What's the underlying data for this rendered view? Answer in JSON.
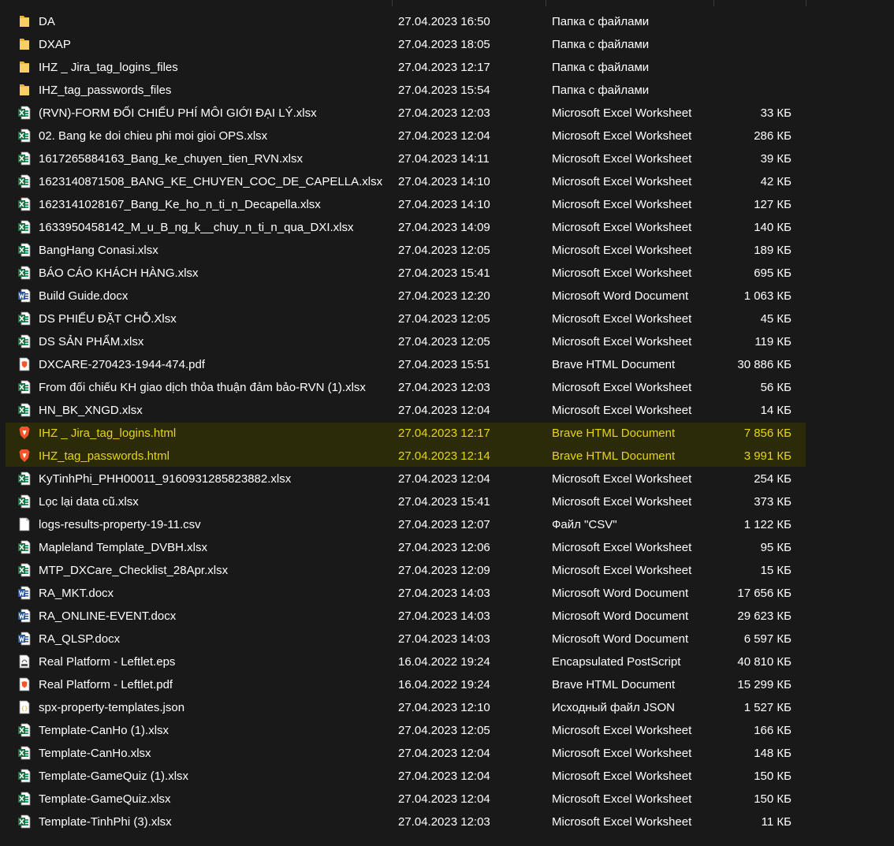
{
  "files": [
    {
      "name": "DA",
      "date": "27.04.2023 16:50",
      "type": "Папка с файлами",
      "size": "",
      "icon": "folder-icon"
    },
    {
      "name": "DXAP",
      "date": "27.04.2023 18:05",
      "type": "Папка с файлами",
      "size": "",
      "icon": "folder-icon"
    },
    {
      "name": "IHZ _ Jira_tag_logins_files",
      "date": "27.04.2023 12:17",
      "type": "Папка с файлами",
      "size": "",
      "icon": "folder-icon"
    },
    {
      "name": "IHZ_tag_passwords_files",
      "date": "27.04.2023 15:54",
      "type": "Папка с файлами",
      "size": "",
      "icon": "folder-icon"
    },
    {
      "name": "(RVN)-FORM ĐỐI CHIẾU PHÍ MÔI GIỚI ĐẠI LÝ.xlsx",
      "date": "27.04.2023 12:03",
      "type": "Microsoft Excel Worksheet",
      "size": "33 КБ",
      "icon": "excel-icon"
    },
    {
      "name": "02. Bang ke doi chieu phi moi gioi OPS.xlsx",
      "date": "27.04.2023 12:04",
      "type": "Microsoft Excel Worksheet",
      "size": "286 КБ",
      "icon": "excel-icon"
    },
    {
      "name": "1617265884163_Bang_ke_chuyen_tien_RVN.xlsx",
      "date": "27.04.2023 14:11",
      "type": "Microsoft Excel Worksheet",
      "size": "39 КБ",
      "icon": "excel-icon"
    },
    {
      "name": "1623140871508_BANG_KE_CHUYEN_COC_DE_CAPELLA.xlsx",
      "date": "27.04.2023 14:10",
      "type": "Microsoft Excel Worksheet",
      "size": "42 КБ",
      "icon": "excel-icon"
    },
    {
      "name": "1623141028167_Bang_Ke_ho_n_ti_n_Decapella.xlsx",
      "date": "27.04.2023 14:10",
      "type": "Microsoft Excel Worksheet",
      "size": "127 КБ",
      "icon": "excel-icon"
    },
    {
      "name": "1633950458142_M_u_B_ng_k__chuy_n_ti_n_qua_DXI.xlsx",
      "date": "27.04.2023 14:09",
      "type": "Microsoft Excel Worksheet",
      "size": "140 КБ",
      "icon": "excel-icon"
    },
    {
      "name": "BangHang Conasi.xlsx",
      "date": "27.04.2023 12:05",
      "type": "Microsoft Excel Worksheet",
      "size": "189 КБ",
      "icon": "excel-icon"
    },
    {
      "name": "BÁO CÁO KHÁCH HÀNG.xlsx",
      "date": "27.04.2023 15:41",
      "type": "Microsoft Excel Worksheet",
      "size": "695 КБ",
      "icon": "excel-icon"
    },
    {
      "name": "Build Guide.docx",
      "date": "27.04.2023 12:20",
      "type": "Microsoft Word Document",
      "size": "1 063 КБ",
      "icon": "word-icon"
    },
    {
      "name": "DS PHIẾU ĐẶT CHỖ.Xlsx",
      "date": "27.04.2023 12:05",
      "type": "Microsoft Excel Worksheet",
      "size": "45 КБ",
      "icon": "excel-icon"
    },
    {
      "name": "DS SẢN PHẨM.xlsx",
      "date": "27.04.2023 12:05",
      "type": "Microsoft Excel Worksheet",
      "size": "119 КБ",
      "icon": "excel-icon"
    },
    {
      "name": "DXCARE-270423-1944-474.pdf",
      "date": "27.04.2023 15:51",
      "type": "Brave HTML Document",
      "size": "30 886 КБ",
      "icon": "pdf-icon"
    },
    {
      "name": "From đối chiếu KH giao dịch thỏa thuận đảm bảo-RVN (1).xlsx",
      "date": "27.04.2023 12:03",
      "type": "Microsoft Excel Worksheet",
      "size": "56 КБ",
      "icon": "excel-icon"
    },
    {
      "name": "HN_BK_XNGD.xlsx",
      "date": "27.04.2023 12:04",
      "type": "Microsoft Excel Worksheet",
      "size": "14 КБ",
      "icon": "excel-icon"
    },
    {
      "name": "IHZ _ Jira_tag_logins.html",
      "date": "27.04.2023 12:17",
      "type": "Brave HTML Document",
      "size": "7 856 КБ",
      "icon": "brave-icon",
      "selected": true
    },
    {
      "name": "IHZ_tag_passwords.html",
      "date": "27.04.2023 12:14",
      "type": "Brave HTML Document",
      "size": "3 991 КБ",
      "icon": "brave-icon",
      "selected": true
    },
    {
      "name": "KyTinhPhi_PHH00011_9160931285823882.xlsx",
      "date": "27.04.2023 12:04",
      "type": "Microsoft Excel Worksheet",
      "size": "254 КБ",
      "icon": "excel-icon"
    },
    {
      "name": "Lọc lại data cũ.xlsx",
      "date": "27.04.2023 15:41",
      "type": "Microsoft Excel Worksheet",
      "size": "373 КБ",
      "icon": "excel-icon"
    },
    {
      "name": "logs-results-property-19-11.csv",
      "date": "27.04.2023 12:07",
      "type": "Файл \"CSV\"",
      "size": "1 122 КБ",
      "icon": "csv-icon"
    },
    {
      "name": "Mapleland Template_DVBH.xlsx",
      "date": "27.04.2023 12:06",
      "type": "Microsoft Excel Worksheet",
      "size": "95 КБ",
      "icon": "excel-icon"
    },
    {
      "name": "MTP_DXCare_Checklist_28Apr.xlsx",
      "date": "27.04.2023 12:09",
      "type": "Microsoft Excel Worksheet",
      "size": "15 КБ",
      "icon": "excel-icon"
    },
    {
      "name": "RA_MKT.docx",
      "date": "27.04.2023 14:03",
      "type": "Microsoft Word Document",
      "size": "17 656 КБ",
      "icon": "word-icon"
    },
    {
      "name": "RA_ONLINE-EVENT.docx",
      "date": "27.04.2023 14:03",
      "type": "Microsoft Word Document",
      "size": "29 623 КБ",
      "icon": "word-icon"
    },
    {
      "name": "RA_QLSP.docx",
      "date": "27.04.2023 14:03",
      "type": "Microsoft Word Document",
      "size": "6 597 КБ",
      "icon": "word-icon"
    },
    {
      "name": "Real Platform - Leftlet.eps",
      "date": "16.04.2022 19:24",
      "type": "Encapsulated PostScript",
      "size": "40 810 КБ",
      "icon": "eps-icon"
    },
    {
      "name": "Real Platform - Leftlet.pdf",
      "date": "16.04.2022 19:24",
      "type": "Brave HTML Document",
      "size": "15 299 КБ",
      "icon": "pdf-icon"
    },
    {
      "name": "spx-property-templates.json",
      "date": "27.04.2023 12:10",
      "type": "Исходный файл JSON",
      "size": "1 527 КБ",
      "icon": "json-icon"
    },
    {
      "name": "Template-CanHo (1).xlsx",
      "date": "27.04.2023 12:05",
      "type": "Microsoft Excel Worksheet",
      "size": "166 КБ",
      "icon": "excel-icon"
    },
    {
      "name": "Template-CanHo.xlsx",
      "date": "27.04.2023 12:04",
      "type": "Microsoft Excel Worksheet",
      "size": "148 КБ",
      "icon": "excel-icon"
    },
    {
      "name": "Template-GameQuiz (1).xlsx",
      "date": "27.04.2023 12:04",
      "type": "Microsoft Excel Worksheet",
      "size": "150 КБ",
      "icon": "excel-icon"
    },
    {
      "name": "Template-GameQuiz.xlsx",
      "date": "27.04.2023 12:04",
      "type": "Microsoft Excel Worksheet",
      "size": "150 КБ",
      "icon": "excel-icon"
    },
    {
      "name": "Template-TinhPhi (3).xlsx",
      "date": "27.04.2023 12:03",
      "type": "Microsoft Excel Worksheet",
      "size": "11 КБ",
      "icon": "excel-icon"
    }
  ],
  "colors": {
    "background": "#191919",
    "text": "#ffffff",
    "selected_text": "#e5d60f",
    "selected_background": "#2b2b0a",
    "excel_green": "#1d6f42",
    "word_blue": "#2b5797",
    "folder_yellow": "#f4c542",
    "brave_orange": "#fb542b"
  }
}
